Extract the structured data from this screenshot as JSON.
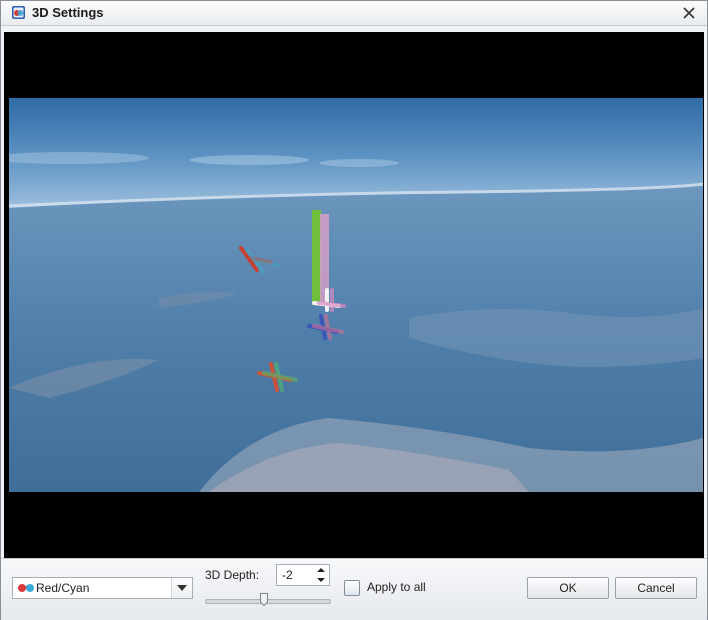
{
  "window": {
    "title": "3D Settings"
  },
  "controls": {
    "mode": {
      "selected": "Red/Cyan"
    },
    "depth": {
      "label": "3D Depth:",
      "value": "-2"
    },
    "apply_all": {
      "label": "Apply to all",
      "checked": false
    }
  },
  "buttons": {
    "ok": "OK",
    "cancel": "Cancel"
  },
  "icons": {
    "app": "3d-app-icon",
    "close": "close-icon",
    "mode": "anaglyph-glasses-icon",
    "dropdown": "chevron-down-icon",
    "spin_up": "spin-up-icon",
    "spin_down": "spin-down-icon"
  }
}
